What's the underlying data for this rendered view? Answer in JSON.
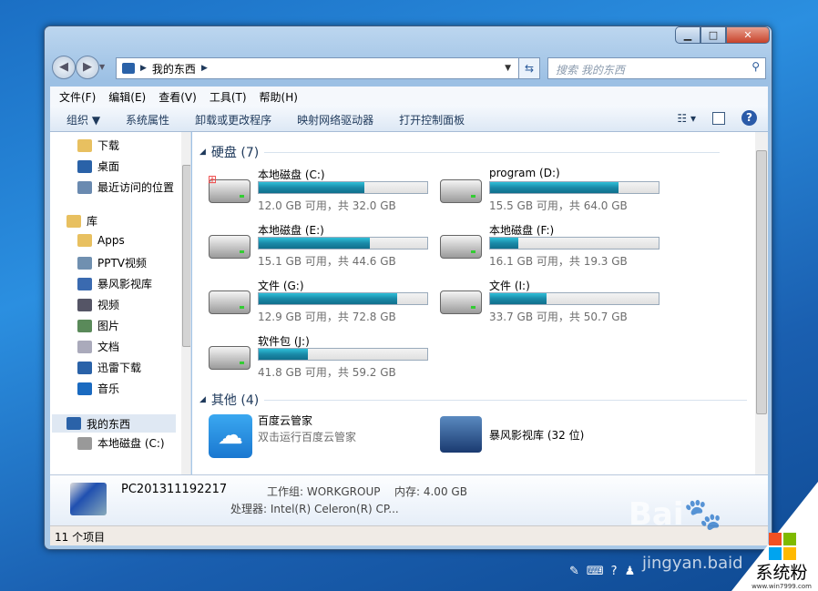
{
  "window": {
    "controls": {
      "minimize": "▁",
      "maximize": "□",
      "close": "✕"
    }
  },
  "address": {
    "path": "我的东西",
    "search_placeholder": "搜索 我的东西"
  },
  "menu": [
    "文件(F)",
    "编辑(E)",
    "查看(V)",
    "工具(T)",
    "帮助(H)"
  ],
  "toolbar": [
    "组织 ▼",
    "系统属性",
    "卸载或更改程序",
    "映射网络驱动器",
    "打开控制面板"
  ],
  "sidebar": [
    {
      "label": "下载",
      "icon": "downloads-folder-icon",
      "color": "#e8c060"
    },
    {
      "label": "桌面",
      "icon": "desktop-icon",
      "color": "#2a62a8"
    },
    {
      "label": "最近访问的位置",
      "icon": "recent-places-icon",
      "color": "#6a8ab0"
    },
    {
      "label": "库",
      "icon": "libraries-icon",
      "color": "#e8c060",
      "group": true
    },
    {
      "label": "Apps",
      "icon": "folder-icon",
      "color": "#e8c060"
    },
    {
      "label": "PPTV视频",
      "icon": "video-folder-icon",
      "color": "#7090b0"
    },
    {
      "label": "暴风影视库",
      "icon": "video-folder-icon",
      "color": "#3a6ab0"
    },
    {
      "label": "视频",
      "icon": "video-icon",
      "color": "#556"
    },
    {
      "label": "图片",
      "icon": "pictures-icon",
      "color": "#5a8a5a"
    },
    {
      "label": "文档",
      "icon": "documents-icon",
      "color": "#aab"
    },
    {
      "label": "迅雷下载",
      "icon": "thunder-folder-icon",
      "color": "#2a62a8"
    },
    {
      "label": "音乐",
      "icon": "music-icon",
      "color": "#1a6ac0"
    },
    {
      "label": "我的东西",
      "icon": "computer-icon",
      "color": "#2a62a8",
      "group": true,
      "selected": true
    },
    {
      "label": "本地磁盘 (C:)",
      "icon": "drive-icon",
      "color": "#999"
    }
  ],
  "groups": {
    "hdd": "硬盘 (7)",
    "other": "其他 (4)"
  },
  "drives": [
    {
      "name": "本地磁盘 (C:)",
      "size": "12.0 GB 可用，共 32.0 GB",
      "used_fraction": 0.625,
      "windows": true
    },
    {
      "name": "program (D:)",
      "size": "15.5 GB 可用，共 64.0 GB",
      "used_fraction": 0.76
    },
    {
      "name": "本地磁盘 (E:)",
      "size": "15.1 GB 可用，共 44.6 GB",
      "used_fraction": 0.66
    },
    {
      "name": "本地磁盘 (F:)",
      "size": "16.1 GB 可用，共 19.3 GB",
      "used_fraction": 0.17
    },
    {
      "name": "文件 (G:)",
      "size": "12.9 GB 可用，共 72.8 GB",
      "used_fraction": 0.82
    },
    {
      "name": "文件 (I:)",
      "size": "33.7 GB 可用，共 50.7 GB",
      "used_fraction": 0.335
    },
    {
      "name": "软件包 (J:)",
      "size": "41.8 GB 可用，共 59.2 GB",
      "used_fraction": 0.29
    }
  ],
  "others": [
    {
      "name": "百度云管家",
      "sub": "双击运行百度云管家"
    },
    {
      "name": "暴风影视库 (32 位)",
      "sub": ""
    }
  ],
  "details": {
    "pc": "PC201311192217",
    "workgroup": "工作组: WORKGROUP",
    "memory": "内存: 4.00 GB",
    "cpu": "处理器: Intel(R) Celeron(R) CP..."
  },
  "status": "11 个项目",
  "watermark": {
    "baidu": "Baidu经验",
    "url": "jingyan.baidu.com",
    "brand": "系统粉",
    "brand_url": "www.win7999.com"
  },
  "colors": {
    "accent": "#1e395b",
    "bar_fill": "#1a8aa8"
  }
}
